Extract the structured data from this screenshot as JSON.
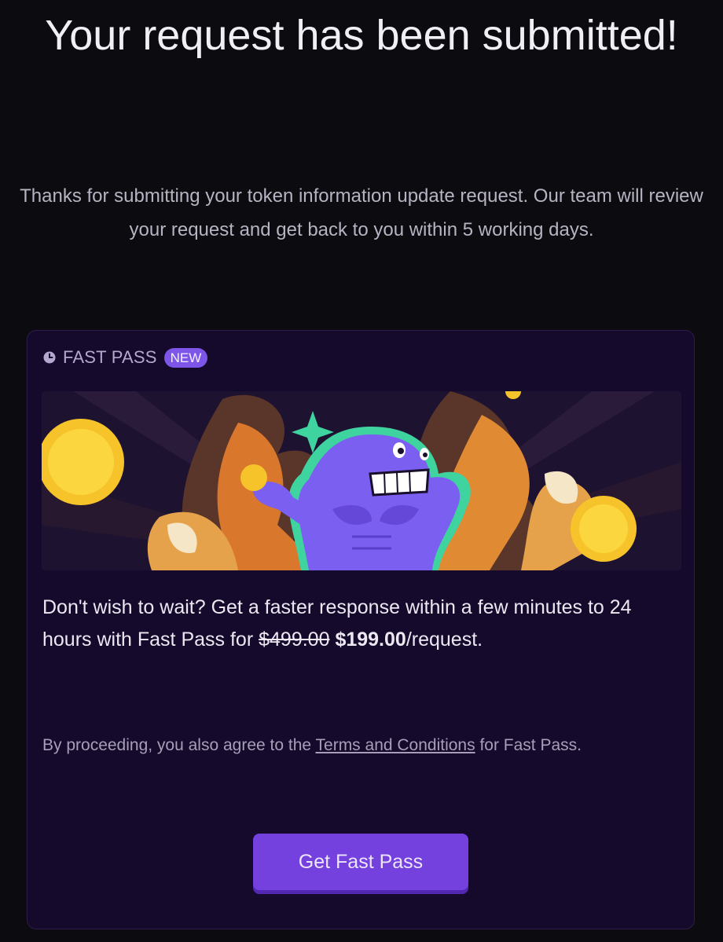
{
  "header": {
    "title": "Your request has been submitted!",
    "message": "Thanks for submitting your token information update request. Our team will review your request and get back to you within 5 working days."
  },
  "card": {
    "label": "FAST PASS",
    "badge": "NEW",
    "offer": {
      "text_before": "Don't wish to wait? Get a faster response within a few minutes to 24 hours with Fast Pass for ",
      "old_price": "$499.00",
      "new_price": "$199.00",
      "suffix": "/request."
    },
    "terms": {
      "prefix": "By proceeding, you also agree to the ",
      "link_text": "Terms and Conditions",
      "suffix": " for Fast Pass."
    },
    "button_label": "Get Fast Pass"
  },
  "colors": {
    "background": "#0c0b10",
    "card_background": "#150a2b",
    "accent": "#7440de",
    "badge": "#7d55e8",
    "mascot": "#7a5ff0",
    "coin": "#f6c42a"
  },
  "icons": {
    "header_icon": "clock-icon",
    "banner": "muscular-mascot-illustration"
  }
}
